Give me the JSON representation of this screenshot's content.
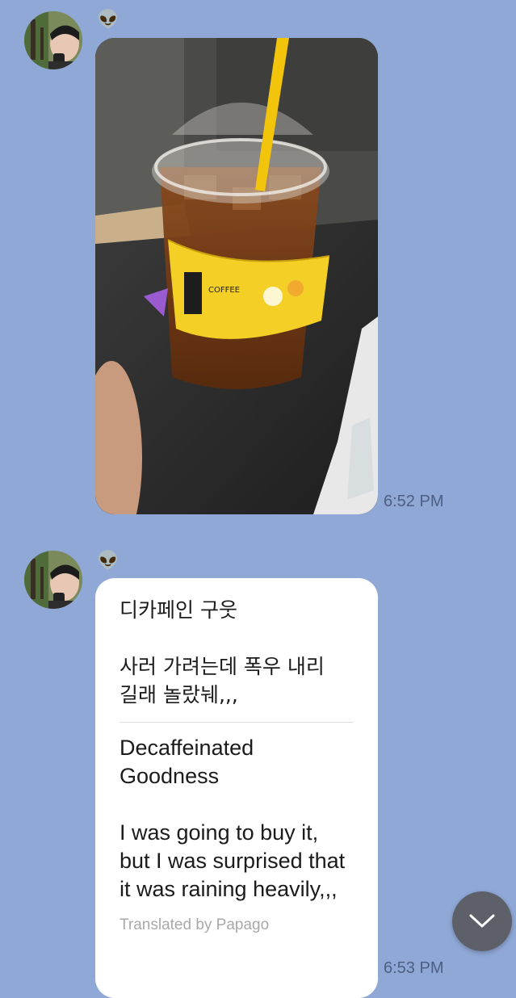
{
  "messages": [
    {
      "type": "photo",
      "sender_icon": "alien-emoji",
      "sender_name": "👽",
      "image_description_icon": "iced-coffee-photo",
      "time": "6:52 PM"
    },
    {
      "type": "text",
      "sender_icon": "alien-emoji",
      "sender_name": "👽",
      "original": {
        "line1": "디카페인 구웃",
        "line2": "사러 가려는데 폭우 내리\n길래 놀랐눼,,,"
      },
      "translation": {
        "line1": "Decaffeinated Goodness",
        "line2": "I was going to buy it, but I was surprised that it was raining heavily,,,"
      },
      "translated_by": "Translated by Papago",
      "time": "6:53 PM"
    }
  ],
  "scroll_button": {
    "icon": "chevron-down-icon"
  },
  "colors": {
    "background": "#8fa8d6",
    "bubble": "#ffffff",
    "time_text": "#4d5f82",
    "scroll_button": "#5d6068"
  }
}
